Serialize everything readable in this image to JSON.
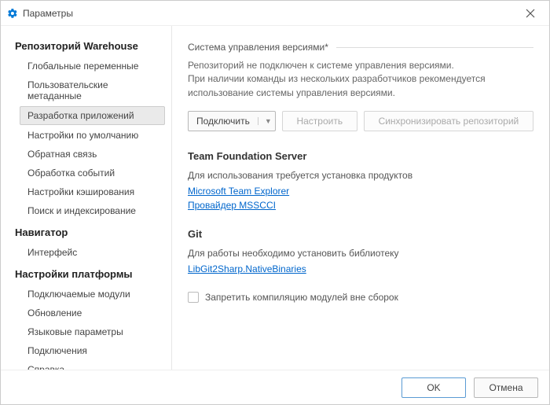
{
  "title": "Параметры",
  "sidebar": {
    "groups": [
      {
        "title": "Репозиторий Warehouse",
        "items": [
          "Глобальные переменные",
          "Пользовательские метаданные",
          "Разработка приложений",
          "Настройки по умолчанию",
          "Обратная связь",
          "Обработка событий",
          "Настройки кэширования",
          "Поиск и индексирование"
        ],
        "selected_index": 2
      },
      {
        "title": "Навигатор",
        "items": [
          "Интерфейс"
        ]
      },
      {
        "title": "Настройки платформы",
        "items": [
          "Подключаемые модули",
          "Обновление",
          "Языковые параметры",
          "Подключения",
          "Справка"
        ]
      }
    ]
  },
  "content": {
    "section_title": "Система управления версиями*",
    "desc_line1": "Репозиторий не подключен к системе управления версиями.",
    "desc_line2": "При наличии команды из нескольких разработчиков рекомендуется использование системы управления версиями.",
    "btn_connect": "Подключить",
    "btn_configure": "Настроить",
    "btn_sync": "Синхронизировать репозиторий",
    "tfs": {
      "title": "Team Foundation Server",
      "desc": "Для использования требуется установка продуктов",
      "link1": "Microsoft Team Explorer",
      "link2": "Провайдер MSSCCI"
    },
    "git": {
      "title": "Git",
      "desc": "Для работы необходимо установить библиотеку",
      "link1": "LibGit2Sharp.NativeBinaries"
    },
    "checkbox_label": "Запретить компиляцию модулей вне сборок"
  },
  "footer": {
    "ok": "OK",
    "cancel": "Отмена"
  }
}
